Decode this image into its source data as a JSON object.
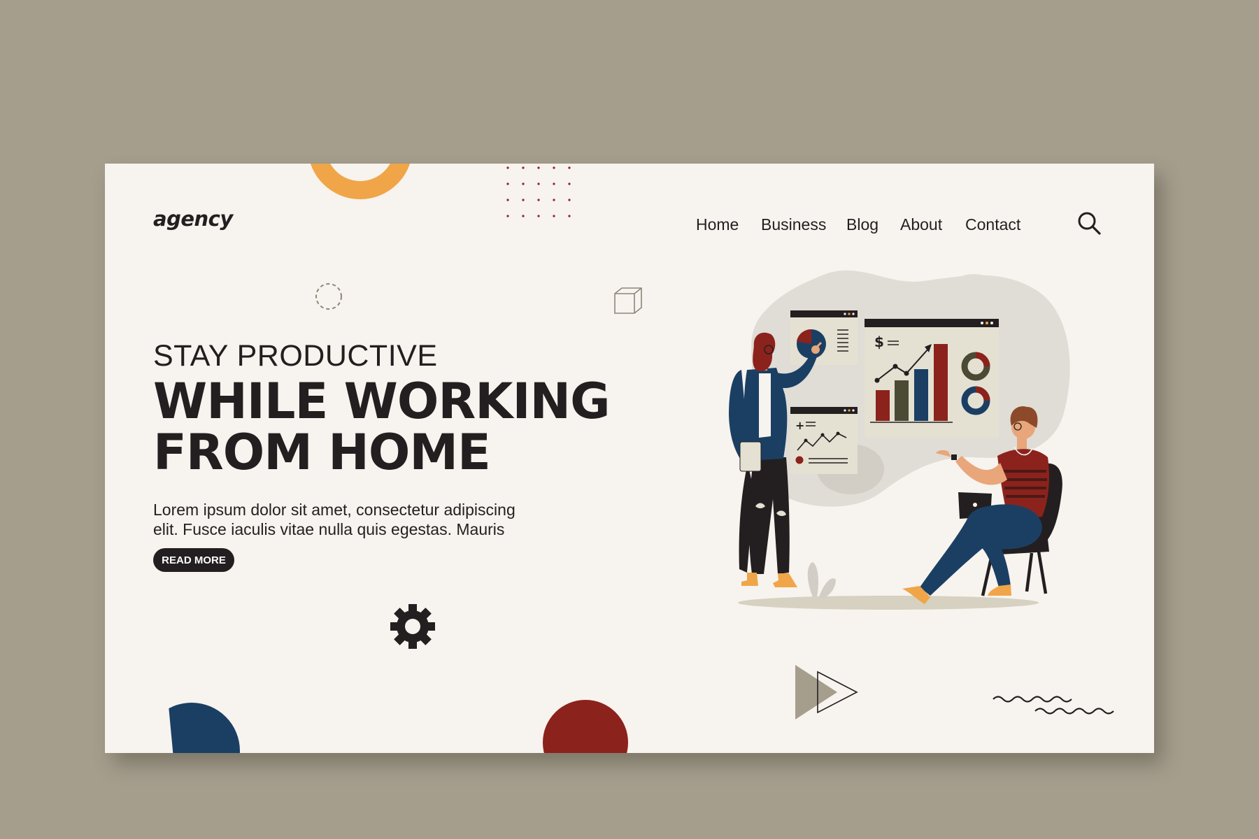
{
  "brand": {
    "logo_text": "agency"
  },
  "nav": {
    "items": [
      {
        "label": "Home"
      },
      {
        "label": "Business"
      },
      {
        "label": "Blog"
      },
      {
        "label": "About"
      },
      {
        "label": "Contact"
      }
    ],
    "search_icon": "search-icon"
  },
  "hero": {
    "eyebrow": "STAY PRODUCTIVE",
    "headline_line1": "WHILE WORKING",
    "headline_line2": "FROM HOME",
    "lead_line1": "Lorem ipsum dolor sit amet, consectetur adipiscing",
    "lead_line2": "elit. Fusce iaculis vitae nulla quis egestas. Mauris",
    "cta_label": "READ MORE"
  },
  "illustration": {
    "dashboard_currency_symbol": "$",
    "dashboard_plus_symbol": "+"
  },
  "colors": {
    "page_bg": "#a59e8d",
    "card_bg": "#f7f3ee",
    "text": "#231f20",
    "accent_orange": "#f0a548",
    "accent_navy": "#1b3f63",
    "accent_red": "#8c221c",
    "accent_olive": "#4a4a35",
    "accent_taupe": "#a59e8d"
  }
}
